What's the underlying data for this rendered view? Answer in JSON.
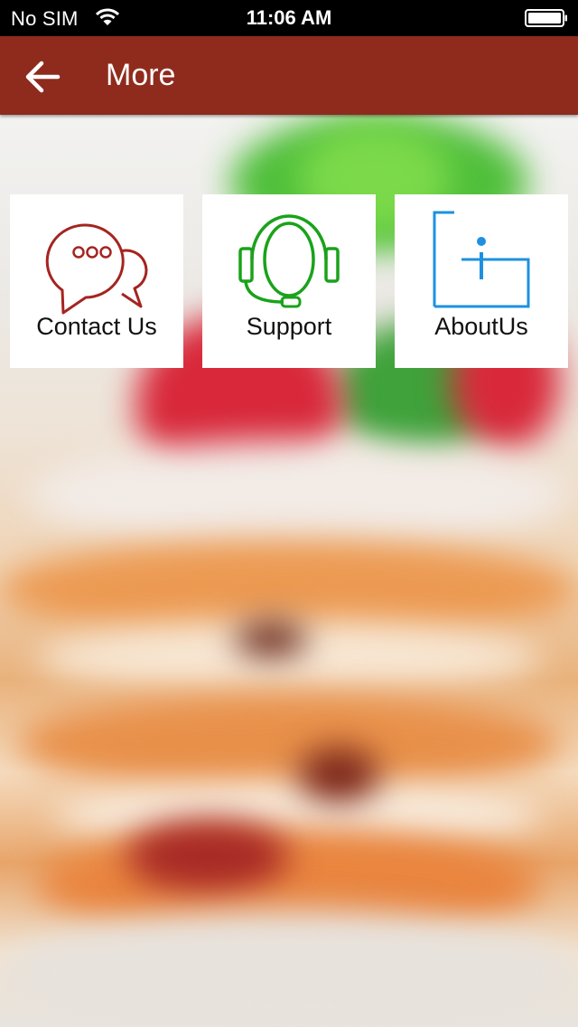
{
  "status_bar": {
    "carrier": "No SIM",
    "time": "11:06 AM"
  },
  "header": {
    "title": "More",
    "background_color": "#8f2b1d"
  },
  "tiles": [
    {
      "label": "Contact Us",
      "icon": "chat-bubbles-icon",
      "color": "#a52420"
    },
    {
      "label": "Support",
      "icon": "headset-icon",
      "color": "#1aa21a"
    },
    {
      "label": "AboutUs",
      "icon": "info-icon",
      "color": "#1e90e0"
    }
  ]
}
